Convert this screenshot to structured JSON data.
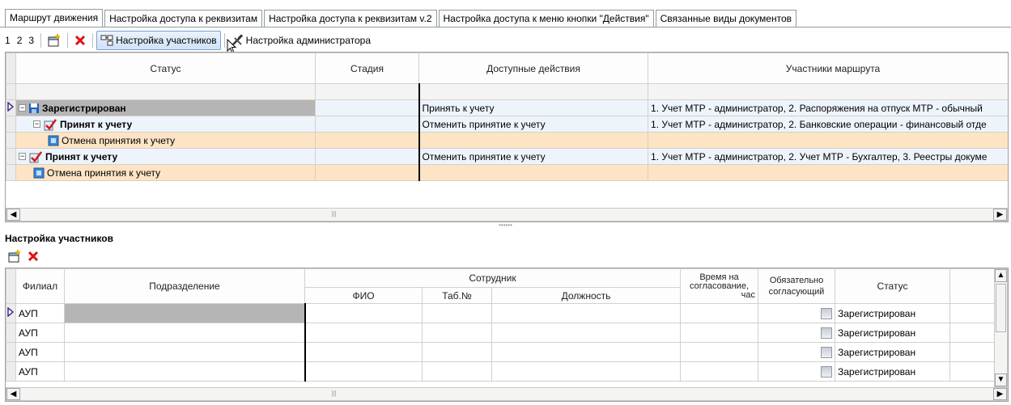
{
  "tabs": [
    {
      "label": "Маршрут движения",
      "active": true
    },
    {
      "label": "Настройка доступа к реквизитам",
      "active": false
    },
    {
      "label": "Настройка доступа к реквизитам v.2",
      "active": false
    },
    {
      "label": "Настройка доступа к меню кнопки \"Действия\"",
      "active": false
    },
    {
      "label": "Связанные виды документов",
      "active": false
    }
  ],
  "toolbar": {
    "step1": "1",
    "step2": "2",
    "step3": "3",
    "participants_label": "Настройка участников",
    "admin_label": "Настройка администратора"
  },
  "route_grid": {
    "columns": {
      "status": "Статус",
      "stage": "Стадия",
      "actions": "Доступные действия",
      "participants": "Участники маршрута"
    },
    "rows": [
      {
        "status": "Зарегистрирован",
        "bold": true,
        "icon": "save-icon",
        "actions": "Принять к учету",
        "participants": "1. Учет МТР - администратор, 2. Распоряжения на отпуск МТР - обычный"
      },
      {
        "status": "Принят к учету",
        "bold": true,
        "icon": "approve-icon",
        "actions": "Отменить принятие к учету",
        "participants": "1. Учет МТР - администратор, 2. Банковские операции - финансовый отде"
      },
      {
        "status": "Отмена принятия к учету",
        "bold": false,
        "icon": "action-icon",
        "actions": "",
        "participants": ""
      },
      {
        "status": "Принят к учету",
        "bold": true,
        "icon": "approve-icon",
        "actions": "Отменить принятие к учету",
        "participants": "1. Учет МТР - администратор, 2. Учет МТР - Бухгалтер, 3. Реестры докуме"
      },
      {
        "status": "Отмена принятия к учету",
        "bold": false,
        "icon": "action-icon",
        "actions": "",
        "participants": ""
      }
    ]
  },
  "participants_section": {
    "title": "Настройка участников",
    "columns": {
      "branch": "Филиал",
      "division": "Подразделение",
      "employee": "Сотрудник",
      "fio": "ФИО",
      "tab_no": "Таб.№",
      "position": "Должность",
      "time_line1": "Время на",
      "time_line2": "согласование,",
      "time_line3": "час",
      "mandatory_line1": "Обязательно",
      "mandatory_line2": "согласующий",
      "status": "Статус"
    },
    "rows": [
      {
        "branch": "АУП",
        "status": "Зарегистрирован"
      },
      {
        "branch": "АУП",
        "status": "Зарегистрирован"
      },
      {
        "branch": "АУП",
        "status": "Зарегистрирован"
      },
      {
        "branch": "АУП",
        "status": "Зарегистрирован"
      }
    ]
  }
}
